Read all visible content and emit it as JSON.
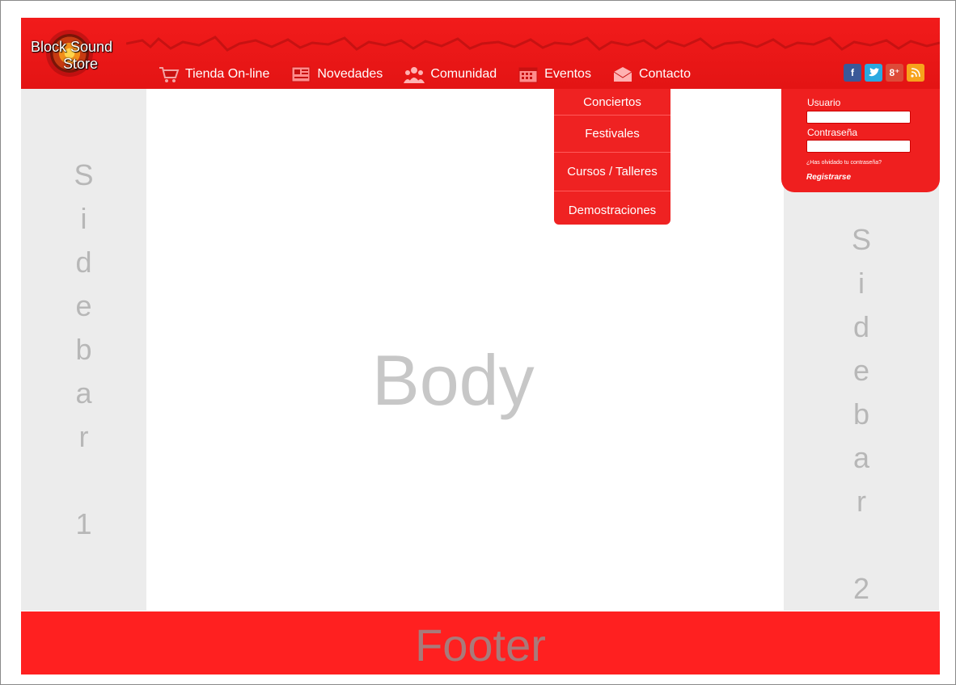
{
  "logo": {
    "line1": "Block Sound",
    "line2": "Store"
  },
  "nav": [
    {
      "label": "Tienda On-line",
      "icon": "shopping-cart-icon"
    },
    {
      "label": "Novedades",
      "icon": "newspaper-icon"
    },
    {
      "label": "Comunidad",
      "icon": "people-icon"
    },
    {
      "label": "Eventos",
      "icon": "calendar-icon"
    },
    {
      "label": "Contacto",
      "icon": "envelope-icon"
    }
  ],
  "social": [
    {
      "glyph": "f",
      "icon": "facebook-icon",
      "color": "#3b5998"
    },
    {
      "glyph": "t",
      "icon": "twitter-icon",
      "color": "#2aa9e0"
    },
    {
      "glyph": "8⁺",
      "icon": "google-plus-icon",
      "color": "#dd4b39"
    },
    {
      "glyph": "rss",
      "icon": "rss-icon",
      "color": "#f7a31c"
    }
  ],
  "dropdown": [
    "Conciertos",
    "Festivales",
    "Cursos / Talleres",
    "Demostraciones"
  ],
  "login": {
    "user_label": "Usuario",
    "password_label": "Contraseña",
    "forgot": "¿Has olvidado tu contraseña?",
    "register": "Registrarse"
  },
  "sidebar1": [
    "S",
    "i",
    "d",
    "e",
    "b",
    "a",
    "r",
    "",
    "1"
  ],
  "sidebar2": [
    "S",
    "i",
    "d",
    "e",
    "b",
    "a",
    "r",
    "",
    "2"
  ],
  "body_label": "Body",
  "footer_label": "Footer",
  "colors": {
    "brand_red": "#ef1f1f",
    "sidebar_gray": "#ececec",
    "placeholder_text": "#c7c7c7"
  }
}
